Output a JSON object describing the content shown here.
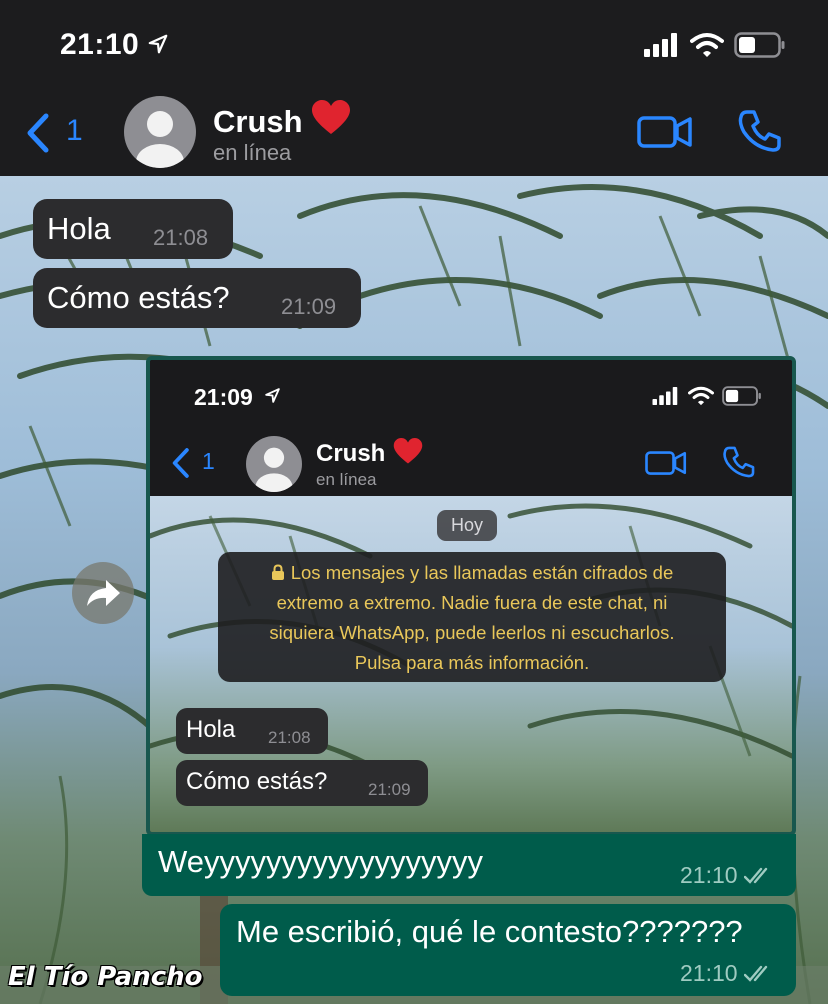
{
  "status_bar": {
    "time": "21:10"
  },
  "header": {
    "back_count": "1",
    "contact_name": "Crush",
    "contact_status": "en línea"
  },
  "messages_in": [
    {
      "text": "Hola",
      "time": "21:08"
    },
    {
      "text": "Cómo estás?",
      "time": "21:09"
    }
  ],
  "forwarded_screenshot": {
    "status_time": "21:09",
    "back_count": "1",
    "contact_name": "Crush",
    "contact_status": "en línea",
    "day_label": "Hoy",
    "encryption_notice": [
      "Los mensajes y las llamadas están cifrados de",
      "extremo a extremo. Nadie fuera de este chat, ni",
      "siquiera WhatsApp, puede leerlos ni escucharlos.",
      "Pulsa para más información."
    ],
    "messages": [
      {
        "text": "Hola",
        "time": "21:08"
      },
      {
        "text": "Cómo estás?",
        "time": "21:09"
      }
    ]
  },
  "messages_out": [
    {
      "text": "Weyyyyyyyyyyyyyyyyyy",
      "time": "21:10"
    },
    {
      "text": "Me escribió, qué le contesto???????",
      "time": "21:10"
    }
  ],
  "watermark": "El Tío Pancho",
  "colors": {
    "accent_blue": "#2a86ff",
    "outgoing_bubble": "#005c4b",
    "incoming_bubble": "#2c2c2e",
    "notice_yellow": "#e9c75a"
  }
}
